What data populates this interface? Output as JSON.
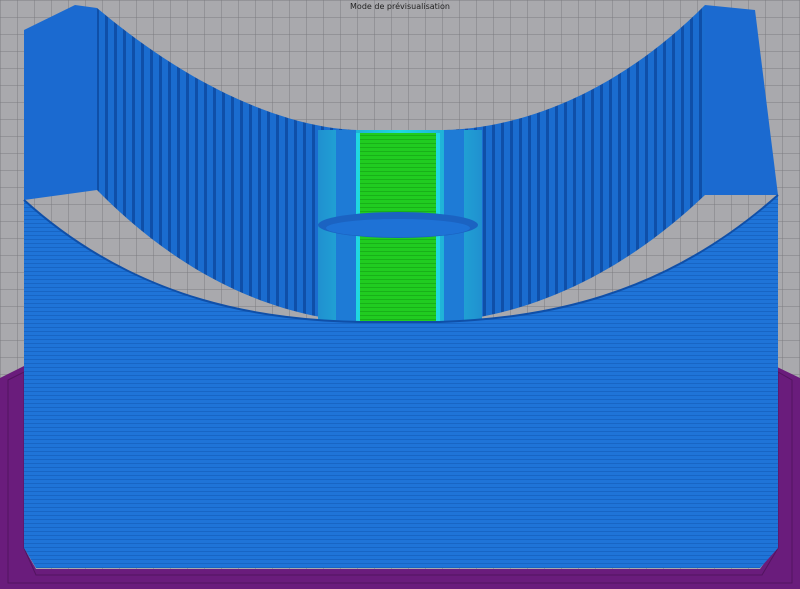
{
  "window": {
    "title": "Mode de prévisualisation"
  },
  "colors": {
    "background": "#a9a9ad",
    "grid_line": "#8c8c91",
    "build_plate_outline": "#6a1c7c",
    "wall_blue": "#1e72d6",
    "wall_blue_dark": "#0f4fa8",
    "wall_blue_light": "#3a8de6",
    "infill_green": "#20cc20",
    "inner_cyan": "#20d8e0"
  },
  "icons": {
    "preview_model": "3d-print-preview"
  }
}
